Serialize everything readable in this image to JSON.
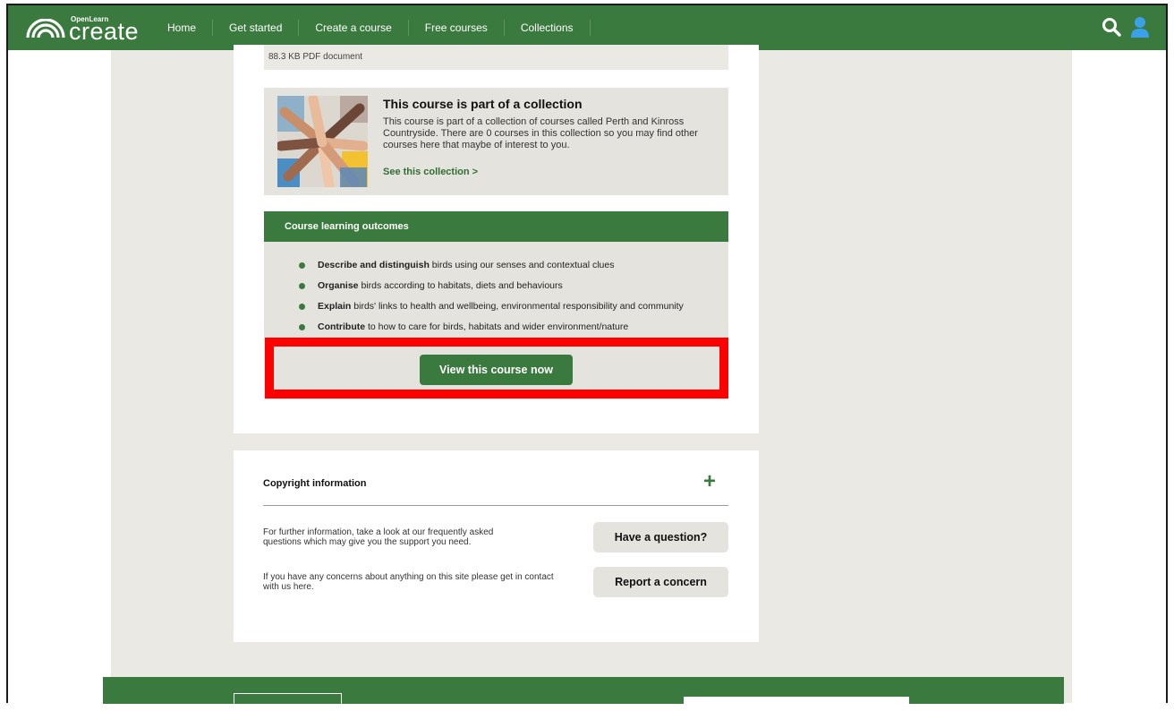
{
  "header": {
    "logo_small": "OpenLearn",
    "logo_big": "create",
    "nav": [
      "Home",
      "Get started",
      "Create a course",
      "Free courses",
      "Collections"
    ]
  },
  "attachment": {
    "meta": "88.3 KB PDF document"
  },
  "collection": {
    "title": "This course is part of a collection",
    "description": "This course is part of a collection of courses called Perth and Kinross Countryside. There are 0 courses in this collection so you may find other courses here that maybe of interest to you.",
    "link": "See this collection",
    "link_chevron": ">"
  },
  "outcomes": {
    "heading": "Course learning outcomes",
    "items": [
      {
        "strong": "Describe and distinguish",
        "rest": " birds using our senses and contextual clues"
      },
      {
        "strong": "Organise",
        "rest": " birds according to habitats, diets and behaviours"
      },
      {
        "strong": "Explain",
        "rest": " birds' links to health and wellbeing, environmental responsibility and community"
      },
      {
        "strong": "Contribute",
        "rest": " to how to care for birds, habitats and wider environment/nature"
      }
    ]
  },
  "cta": {
    "label": "View this course now"
  },
  "copyright": {
    "heading": "Copyright information",
    "toggle": "+",
    "faq_text": "For further information, take a look at our frequently asked questions which may give you the support you need.",
    "faq_button": "Have a question?",
    "concern_text": "If you have any concerns about anything on this site please get in contact with us here.",
    "concern_button": "Report a concern"
  },
  "colors": {
    "brand_green": "#3b7a3f",
    "highlight": "#ff0000",
    "panel_grey": "#e5e3de"
  },
  "icons": {
    "search": "search-icon",
    "user": "user-icon",
    "logo": "rainbow-arc-logo-icon"
  }
}
